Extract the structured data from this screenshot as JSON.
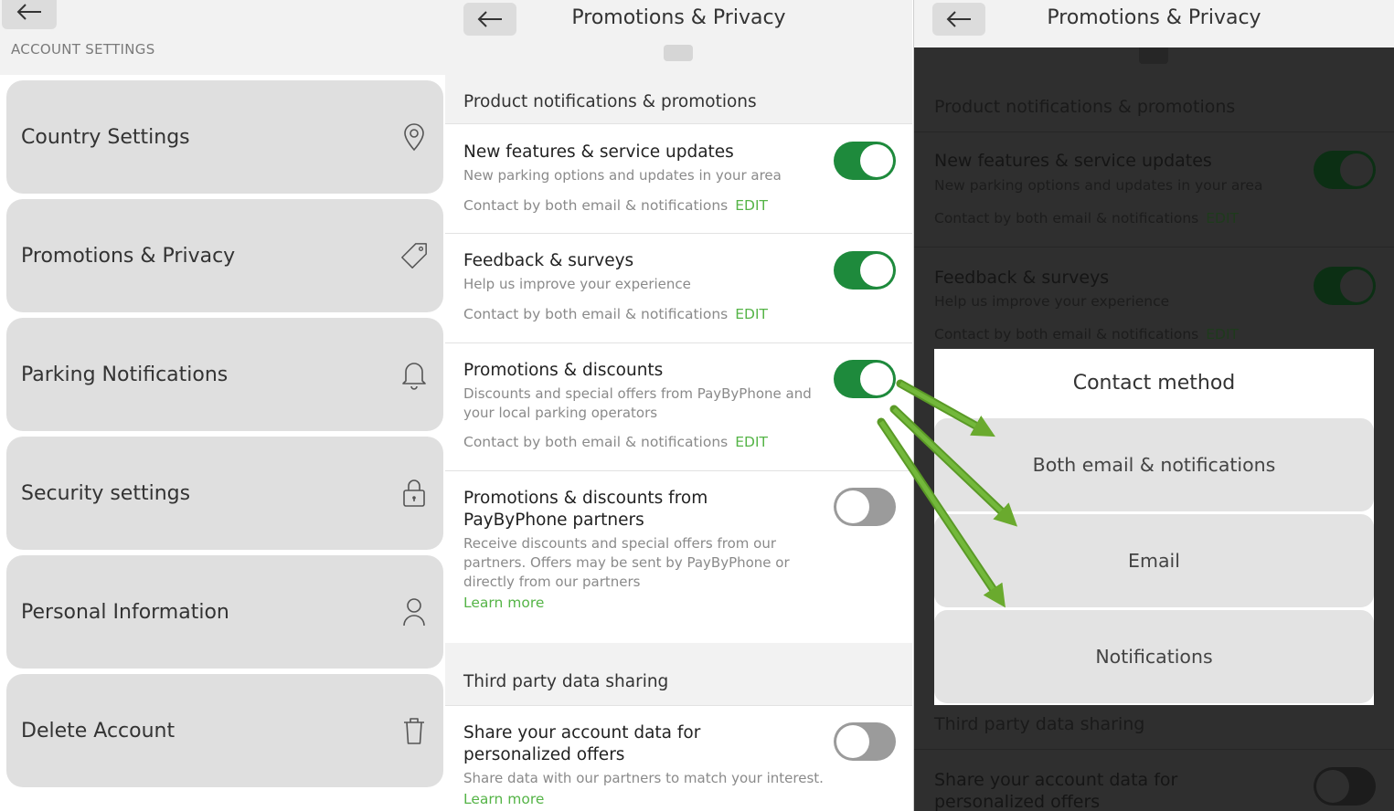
{
  "account_settings": {
    "section_label": "ACCOUNT SETTINGS",
    "items": [
      {
        "label": "Country Settings",
        "icon": "location-pin-icon"
      },
      {
        "label": "Promotions & Privacy",
        "icon": "tag-icon"
      },
      {
        "label": "Parking Notifications",
        "icon": "bell-icon"
      },
      {
        "label": "Security settings",
        "icon": "lock-icon"
      },
      {
        "label": "Personal Information",
        "icon": "person-icon"
      },
      {
        "label": "Delete Account",
        "icon": "trash-icon"
      }
    ]
  },
  "privacy": {
    "title": "Promotions & Privacy",
    "section1": "Product notifications & promotions",
    "rows": [
      {
        "title": "New features & service updates",
        "desc": "New parking options and updates in your area",
        "contact": "Contact by both email & notifications",
        "edit": "EDIT",
        "enabled": true
      },
      {
        "title": "Feedback & surveys",
        "desc": "Help us improve your experience",
        "contact": "Contact by both email & notifications",
        "edit": "EDIT",
        "enabled": true
      },
      {
        "title": "Promotions & discounts",
        "desc_line1": "Discounts and special offers from PayByPhone and",
        "desc_line2": "your local parking operators",
        "contact": "Contact by both email & notifications",
        "edit": "EDIT",
        "enabled": true
      },
      {
        "title_line1": "Promotions & discounts from",
        "title_line2": "PayByPhone partners",
        "desc_line1": "Receive discounts and special offers from our",
        "desc_line2": "partners. Offers may be sent by PayByPhone or",
        "desc_line3": "directly from our partners",
        "learn_more": "Learn more",
        "enabled": false
      }
    ],
    "section2": "Third party data sharing",
    "share_row": {
      "title_line1": "Share your account data for",
      "title_line2": "personalized offers",
      "desc": "Share data with our partners to match your interest.",
      "learn_more": "Learn more",
      "enabled": false
    }
  },
  "contact_modal": {
    "title": "Contact method",
    "options": [
      "Both email & notifications",
      "Email",
      "Notifications"
    ]
  },
  "colors": {
    "toggle_on": "#1e8a3c",
    "link_green": "#55b447",
    "annotation_arrow": "#6aaa2e"
  }
}
